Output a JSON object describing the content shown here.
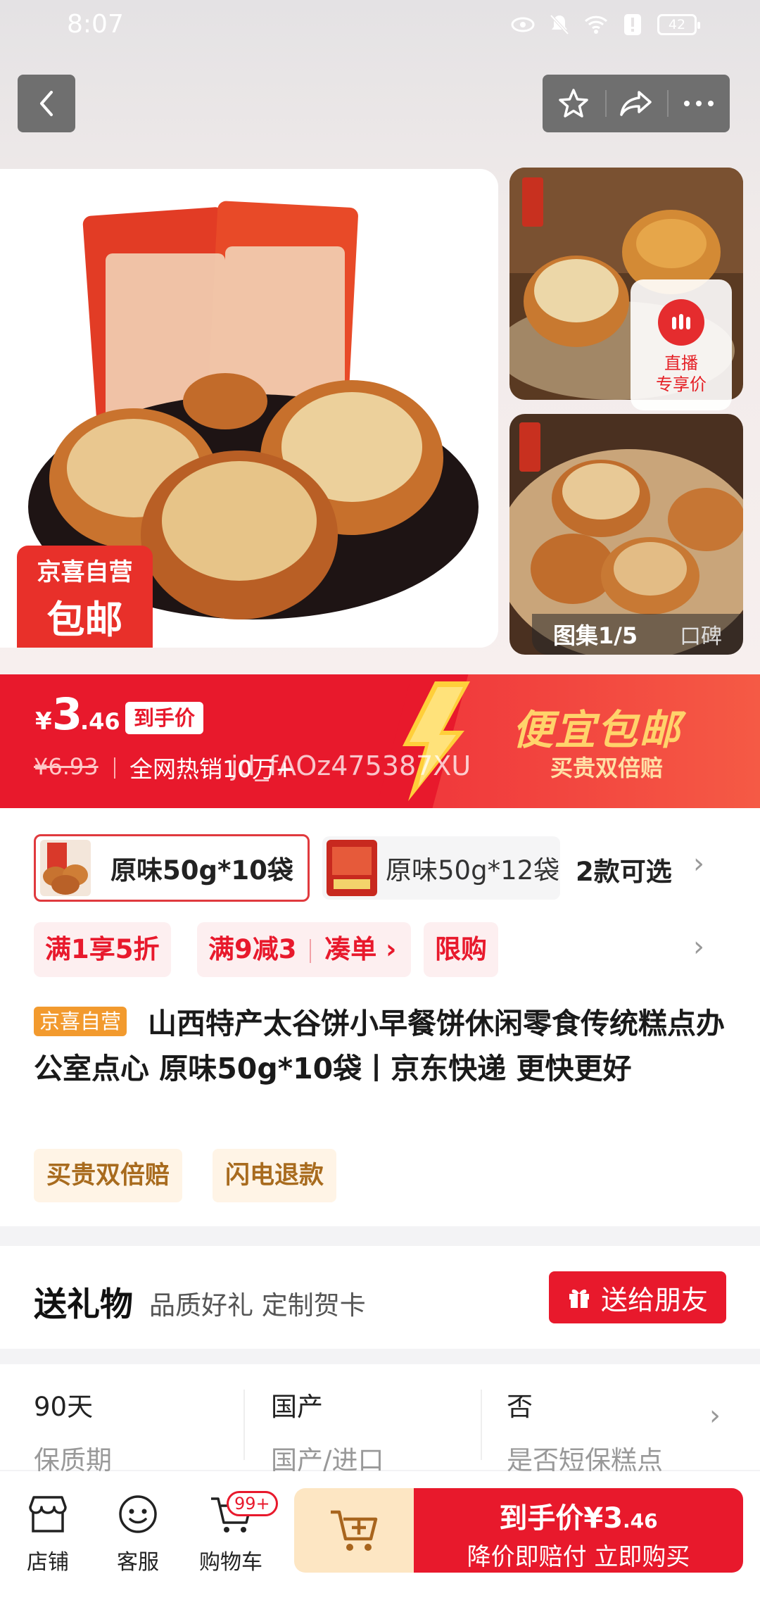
{
  "status_bar": {
    "time": "8:07",
    "battery": "42"
  },
  "gallery": {
    "live_line1": "直播",
    "live_line2": "专享价",
    "gallery_label": "图集1/5",
    "reviews_label": "口碑"
  },
  "badge": {
    "line1": "京喜自营",
    "line2": "包邮"
  },
  "price": {
    "currency": "¥",
    "integer": "3",
    "decimal": ".46",
    "tag": "到手价",
    "original": "¥6.93",
    "hot": "全网热销10万+",
    "watermark": "jd_fAOz475387XU",
    "slogan": "便宜包邮",
    "slogan_sub": "买贵双倍赔"
  },
  "sku": {
    "selected": "原味50g*10袋",
    "other": "原味50g*12袋",
    "count": "2款可选"
  },
  "promos": [
    "满1享5折",
    "满9减3",
    "凑单 ›",
    "限购"
  ],
  "product": {
    "store_tag": "京喜自营",
    "title": "山西特产太谷饼小早餐饼休闲零食传统糕点办公室点心 原味50g*10袋丨京东快递 更快更好"
  },
  "services": [
    "买贵双倍赔",
    "闪电退款"
  ],
  "gift": {
    "heading": "送礼物",
    "sub": "品质好礼 定制贺卡",
    "button": "送给朋友"
  },
  "specs": [
    {
      "value": "90天",
      "key": "保质期"
    },
    {
      "value": "国产",
      "key": "国产/进口"
    },
    {
      "value": "否",
      "key": "是否短保糕点"
    }
  ],
  "bottom": {
    "store": "店铺",
    "service": "客服",
    "cart": "购物车",
    "cart_badge": "99+",
    "buy_line1": "到手价",
    "buy_price": "¥3",
    "buy_decimal": ".46",
    "buy_line2": "降价即赔付 立即购买"
  },
  "colors": {
    "primary_red": "#e8192c",
    "gold": "#ffd36b",
    "store_orange": "#f29a2e"
  }
}
